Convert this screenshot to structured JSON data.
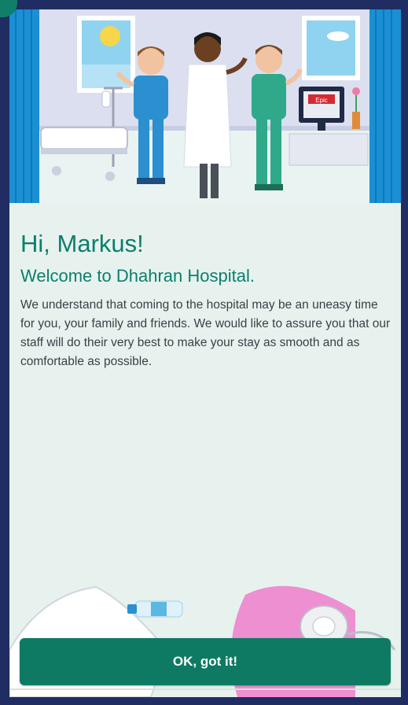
{
  "greeting": "Hi, Markus!",
  "welcome": "Welcome to Dhahran Hospital.",
  "message": "We understand that coming to the hospital may be an uneasy time for you, your family and friends. We would like to assure you that our staff will do their very best to make your stay as smooth and as comfortable as possible.",
  "button": {
    "label": "OK, got it!"
  },
  "monitor_logo": "Epic",
  "colors": {
    "accent": "#0b7f6c",
    "button": "#0f7a63",
    "frame": "#1f2d63",
    "background": "#e7f2ef",
    "body_text": "#3a3f45"
  },
  "icons": [
    "hospital-staff-illustration",
    "hospital-room-illustration",
    "medical-supplies-illustration",
    "water-bottle-icon"
  ]
}
